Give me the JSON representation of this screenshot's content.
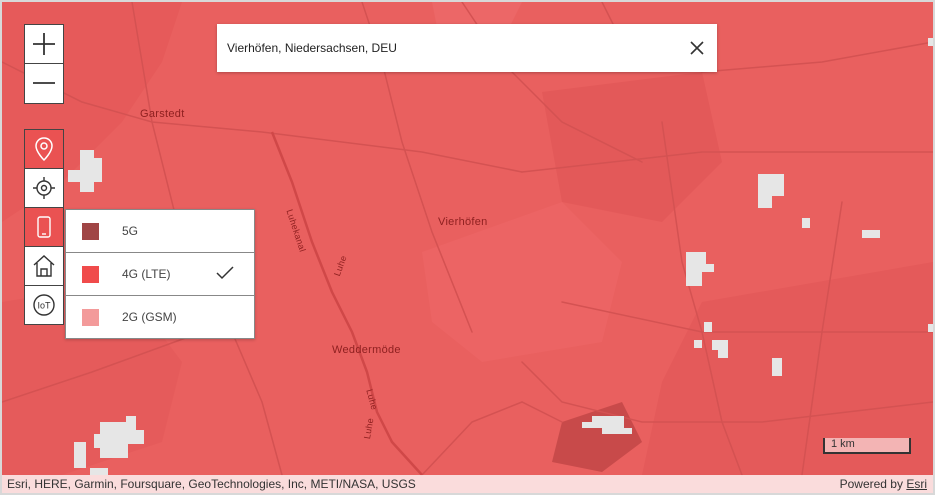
{
  "search": {
    "value": "Vierhöfen, Niedersachsen, DEU",
    "clear_icon": "close-icon"
  },
  "zoom": {
    "in_icon": "plus-icon",
    "out_icon": "minus-icon"
  },
  "tools": [
    {
      "name": "location-pin-icon",
      "active": true
    },
    {
      "name": "crosshair-icon",
      "active": false
    },
    {
      "name": "smartphone-icon",
      "active": true
    },
    {
      "name": "house-icon",
      "active": false
    },
    {
      "name": "iot-icon",
      "active": false
    }
  ],
  "network_layers": [
    {
      "label": "5G",
      "color": "#a04545",
      "selected": false
    },
    {
      "label": "4G (LTE)",
      "color": "#f04b4b",
      "selected": true
    },
    {
      "label": "2G (GSM)",
      "color": "#f39a9a",
      "selected": false
    }
  ],
  "places": {
    "garstedt": "Garstedt",
    "vierhoefen": "Vierhöfen",
    "weddermoede": "Weddermöde",
    "luhekanal": "Luhekanal",
    "luhe1": "Luhe",
    "luhe2": "Luhe",
    "luhe3": "Luhe"
  },
  "scale": {
    "label": "1 km"
  },
  "attribution": {
    "sources": "Esri, HERE, Garmin, Foursquare, GeoTechnologies, Inc, METI/NASA, USGS",
    "powered_prefix": "Powered by",
    "powered_link": "Esri"
  },
  "colors": {
    "coverage": "#e9605f",
    "accent": "#ea5252"
  }
}
